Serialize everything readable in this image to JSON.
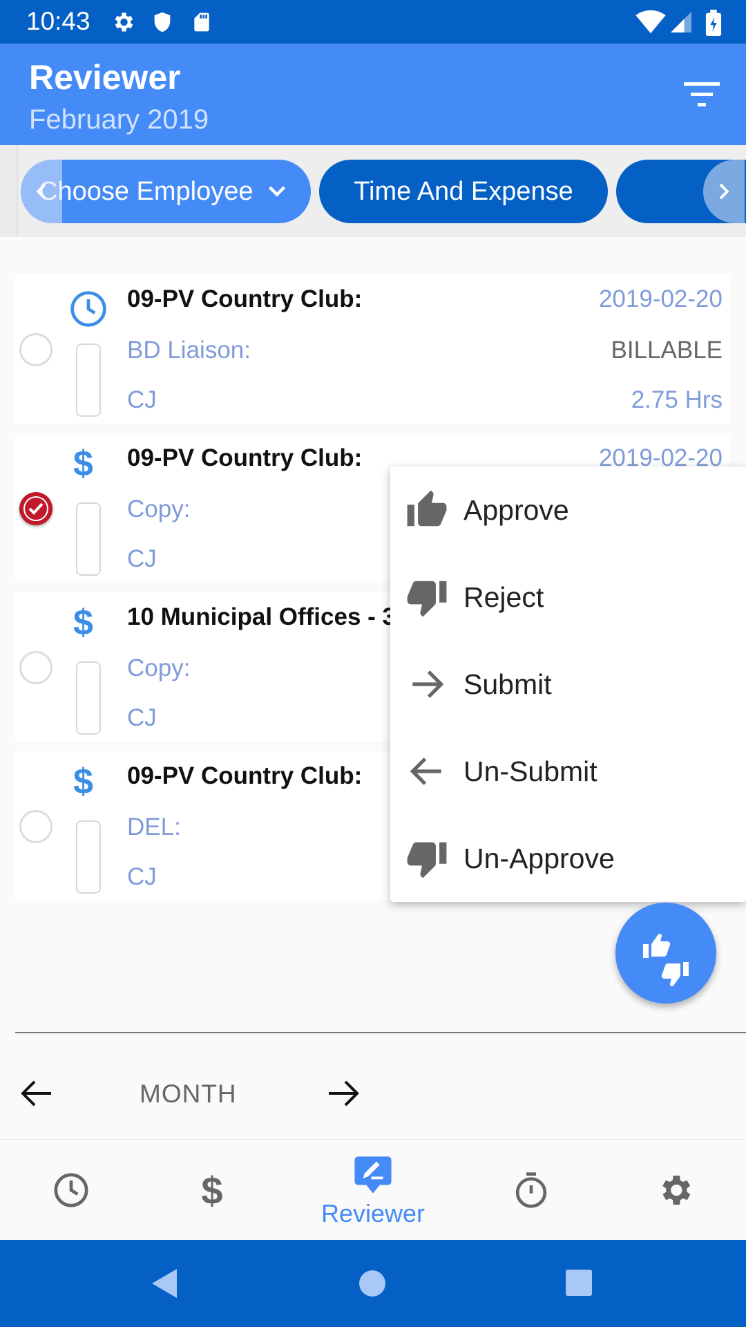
{
  "status_bar": {
    "time": "10:43",
    "icons": [
      "settings-icon",
      "shield-icon",
      "sd-card-icon",
      "wifi-icon",
      "signal-icon",
      "battery-icon"
    ]
  },
  "app_bar": {
    "title": "Reviewer",
    "subtitle": "February 2019",
    "filter_icon": "filter-icon"
  },
  "chips": [
    {
      "label": "Choose Employee",
      "icon": "chevron-down-icon"
    },
    {
      "label": "Time And Expense"
    },
    {
      "label": ""
    }
  ],
  "list": {
    "items": [
      {
        "type": "time",
        "icon": "clock-icon",
        "title": "09-PV Country Club:",
        "line2": "BD Liaison:",
        "line3": "CJ",
        "date": "2019-02-20",
        "status": "BILLABLE",
        "hours": "2.75 Hrs",
        "checked": false
      },
      {
        "type": "expense",
        "icon": "dollar-icon",
        "title": "09-PV Country Club:",
        "line2": "Copy:",
        "line3": "CJ",
        "date": "2019-02-20",
        "checked": true
      },
      {
        "type": "expense",
        "icon": "dollar-icon",
        "title": "10 Municipal Offices - 3",
        "line2": "Copy:",
        "line3": "CJ",
        "checked": false
      },
      {
        "type": "expense",
        "icon": "dollar-icon",
        "title": "09-PV Country Club:",
        "line2": "DEL:",
        "line3": "CJ",
        "checked": false
      }
    ]
  },
  "popup_menu": {
    "items": [
      {
        "label": "Approve",
        "icon": "thumb-up-icon"
      },
      {
        "label": "Reject",
        "icon": "thumb-down-icon"
      },
      {
        "label": "Submit",
        "icon": "arrow-right-icon"
      },
      {
        "label": "Un-Submit",
        "icon": "arrow-left-icon"
      },
      {
        "label": "Un-Approve",
        "icon": "thumb-down-icon"
      }
    ]
  },
  "fab": {
    "icon": "thumbs-up-down-icon"
  },
  "month_nav": {
    "label": "MONTH"
  },
  "bottom_nav": {
    "items": [
      {
        "icon": "clock-icon"
      },
      {
        "icon": "dollar-icon"
      },
      {
        "icon": "reviewer-icon",
        "label": "Reviewer",
        "active": true
      },
      {
        "icon": "timer-icon"
      },
      {
        "icon": "settings-icon"
      }
    ]
  },
  "colors": {
    "primary": "#448bf7",
    "primary_dark": "#0560c6",
    "accent_text": "#7f9bd9",
    "checked": "#c01a2a"
  }
}
